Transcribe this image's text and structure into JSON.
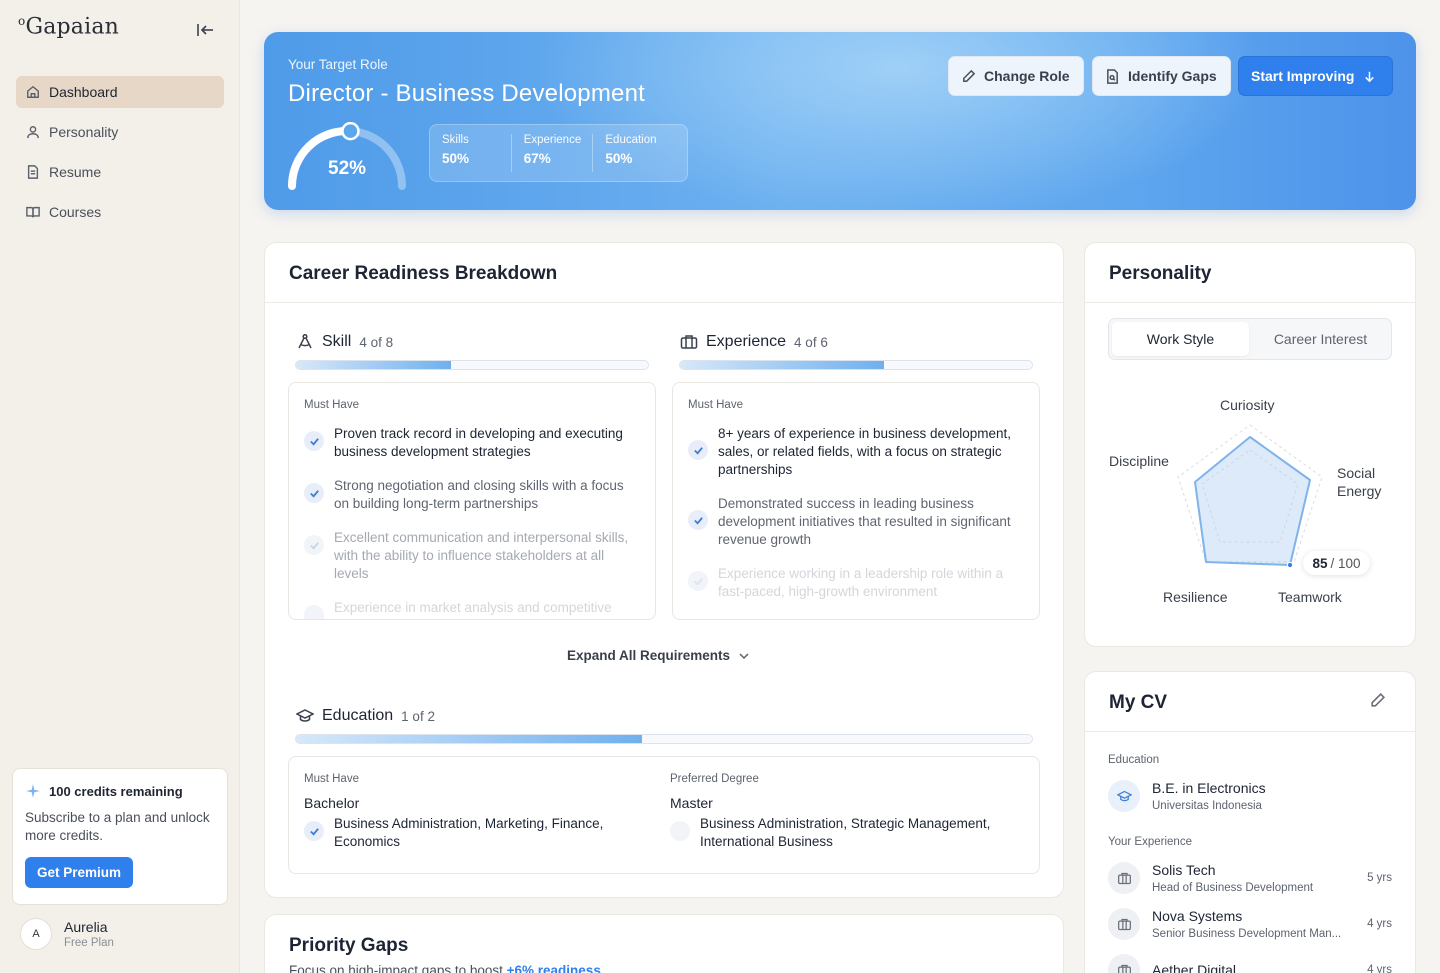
{
  "app": {
    "logo": "Gapaian",
    "logo_mark": "o"
  },
  "sidebar": {
    "items": [
      {
        "label": "Dashboard",
        "icon": "home-icon",
        "active": true
      },
      {
        "label": "Personality",
        "icon": "user-icon"
      },
      {
        "label": "Resume",
        "icon": "file-icon"
      },
      {
        "label": "Courses",
        "icon": "book-icon"
      }
    ],
    "credits": {
      "title": "100 credits remaining",
      "desc": "Subscribe to a plan and unlock more credits.",
      "button": "Get Premium"
    },
    "user": {
      "initial": "A",
      "name": "Aurelia",
      "plan": "Free Plan"
    }
  },
  "hero": {
    "label": "Your Target Role",
    "role": "Director - Business Development",
    "readiness": "52%",
    "readiness_fraction": 0.52,
    "stats": [
      {
        "label": "Skills",
        "value": "50%"
      },
      {
        "label": "Experience",
        "value": "67%"
      },
      {
        "label": "Education",
        "value": "50%"
      }
    ],
    "buttons": {
      "change_role": "Change Role",
      "identify_gaps": "Identify Gaps",
      "start_improving": "Start Improving"
    }
  },
  "breakdown": {
    "title": "Career Readiness Breakdown",
    "skill": {
      "title": "Skill",
      "count": "4 of 8",
      "progress": 0.44,
      "must_have": "Must Have",
      "items": [
        "Proven track record in developing and executing business development strategies",
        "Strong negotiation and closing skills with a focus on building long-term partnerships",
        "Excellent communication and interpersonal skills, with the ability to influence stakeholders at all levels",
        "Experience in market analysis and competitive"
      ]
    },
    "experience": {
      "title": "Experience",
      "count": "4 of 6",
      "progress": 0.58,
      "must_have": "Must Have",
      "items": [
        "8+ years of experience in business development, sales, or related fields, with a focus on strategic partnerships",
        "Demonstrated success in leading business development initiatives that resulted in significant revenue growth",
        "Experience working in a leadership role within a fast-paced, high-growth environment"
      ]
    },
    "expand": "Expand All Requirements",
    "education": {
      "title": "Education",
      "count": "1 of 2",
      "progress": 0.47,
      "must_have": {
        "label": "Must Have",
        "degree": "Bachelor",
        "fields": "Business Administration, Marketing, Finance, Economics"
      },
      "preferred": {
        "label": "Preferred Degree",
        "degree": "Master",
        "fields": "Business Administration, Strategic Management, International Business"
      }
    }
  },
  "priority_gaps": {
    "title": "Priority Gaps",
    "subtitle_prefix": "Focus on high-impact gaps to boost",
    "subtitle_highlight": "+6% readiness"
  },
  "personality": {
    "title": "Personality",
    "tabs": [
      "Work Style",
      "Career Interest"
    ],
    "radar_labels": {
      "top": "Curiosity",
      "left": "Discipline",
      "right": "Social Energy",
      "bottom_left": "Resilience",
      "bottom_right": "Teamwork"
    },
    "score": "85",
    "score_total": "/ 100"
  },
  "cv": {
    "title": "My CV",
    "education_label": "Education",
    "education": {
      "degree": "B.E. in Electronics",
      "school": "Universitas Indonesia"
    },
    "experience_label": "Your Experience",
    "experience": [
      {
        "company": "Solis Tech",
        "role": "Head of Business Development",
        "years": "5 yrs"
      },
      {
        "company": "Nova Systems",
        "role": "Senior Business Development Man...",
        "years": "4 yrs"
      },
      {
        "company": "Aether Digital",
        "role": "",
        "years": "4 yrs"
      }
    ]
  },
  "colors": {
    "accent": "#2f80ed",
    "active_nav": "#e6d7c7",
    "hero_start": "#4f9be9",
    "hero_end": "#4d93ea"
  }
}
